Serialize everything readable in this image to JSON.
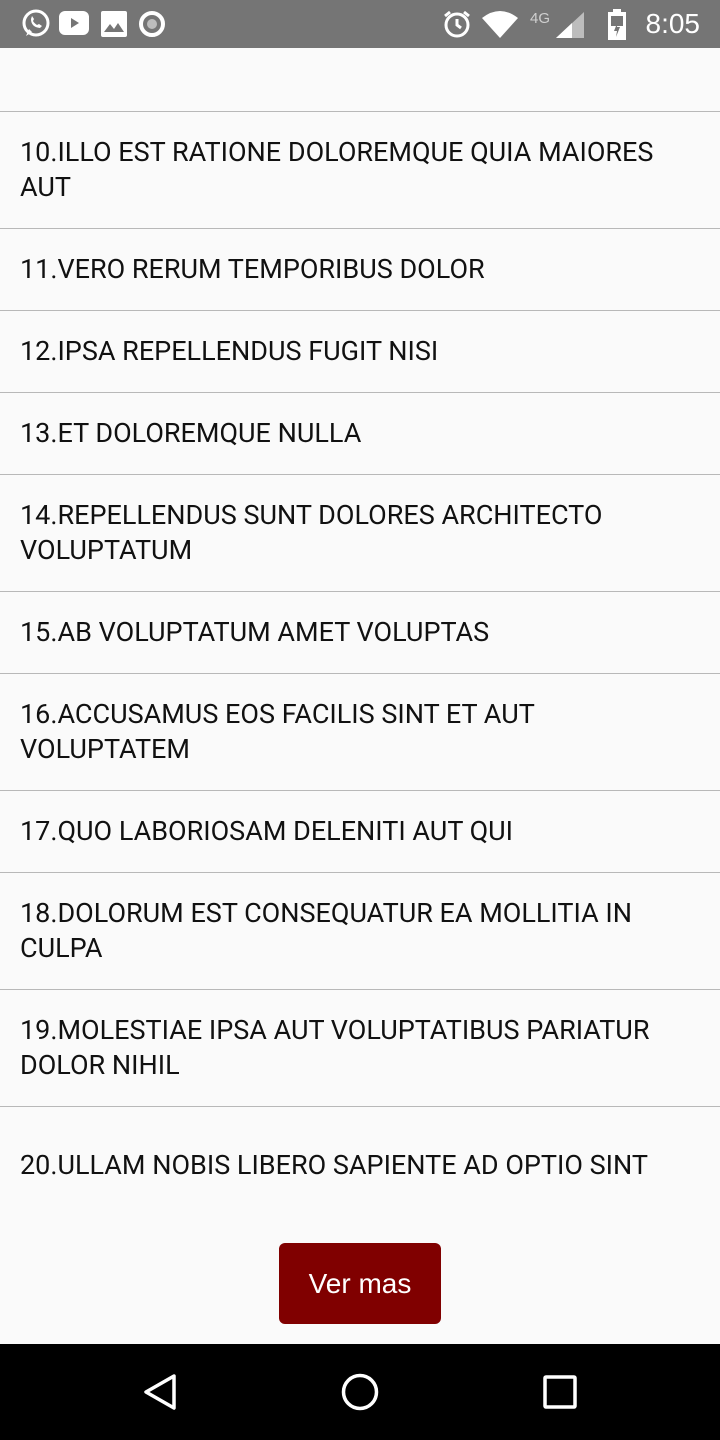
{
  "status_bar": {
    "left_icons": [
      "whatsapp-icon",
      "youtube-icon",
      "gallery-icon",
      "circle-icon"
    ],
    "right_icons": [
      "alarm-icon",
      "wifi-icon",
      "signal-icon",
      "battery-icon"
    ],
    "network_label": "4G",
    "time": "8:05"
  },
  "list": {
    "items": [
      {
        "label": "10.ILLO EST RATIONE DOLOREMQUE QUIA MAIORES AUT"
      },
      {
        "label": "11.VERO RERUM TEMPORIBUS DOLOR"
      },
      {
        "label": "12.IPSA REPELLENDUS FUGIT NISI"
      },
      {
        "label": "13.ET DOLOREMQUE NULLA"
      },
      {
        "label": "14.REPELLENDUS SUNT DOLORES ARCHITECTO VOLUPTATUM"
      },
      {
        "label": "15.AB VOLUPTATUM AMET VOLUPTAS"
      },
      {
        "label": "16.ACCUSAMUS EOS FACILIS SINT ET AUT VOLUPTATEM"
      },
      {
        "label": "17.QUO LABORIOSAM DELENITI AUT QUI"
      },
      {
        "label": "18.DOLORUM EST CONSEQUATUR EA MOLLITIA IN CULPA"
      },
      {
        "label": "19.MOLESTIAE IPSA AUT VOLUPTATIBUS PARIATUR DOLOR NIHIL"
      },
      {
        "label": "20.ULLAM NOBIS LIBERO SAPIENTE AD OPTIO SINT"
      }
    ]
  },
  "more_button": {
    "label": "Ver mas",
    "color": "#800000"
  },
  "nav_bar": {
    "buttons": [
      "back-icon",
      "home-icon",
      "recents-icon"
    ]
  }
}
